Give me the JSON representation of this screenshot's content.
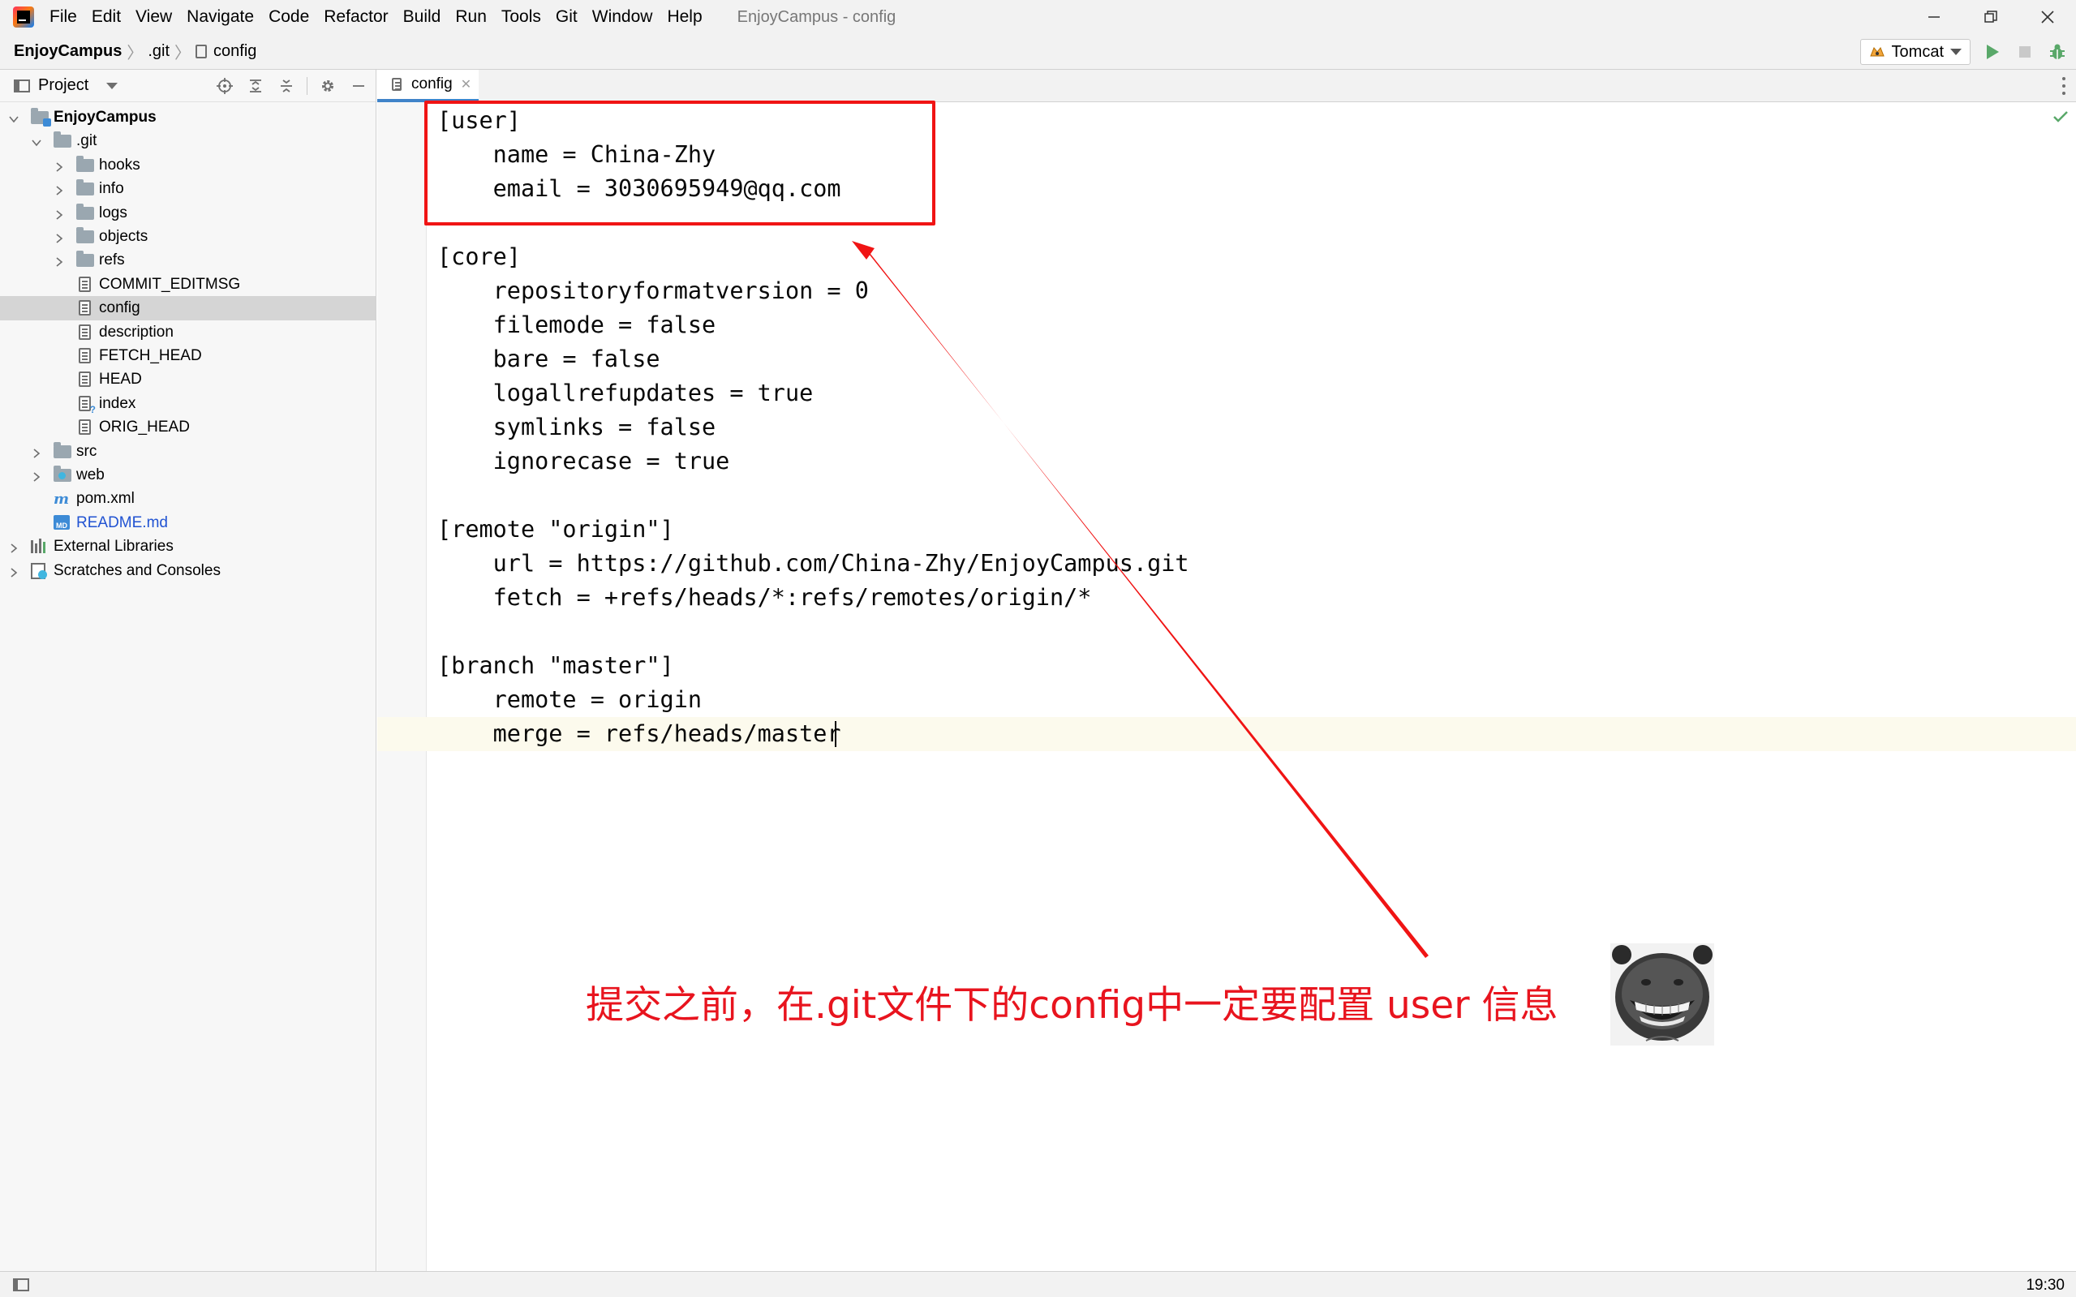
{
  "menubar": {
    "items": [
      "File",
      "Edit",
      "View",
      "Navigate",
      "Code",
      "Refactor",
      "Build",
      "Run",
      "Tools",
      "Git",
      "Window",
      "Help"
    ],
    "window_title": "EnjoyCampus - config"
  },
  "navbar": {
    "breadcrumb": [
      "EnjoyCampus",
      ".git",
      "config"
    ],
    "run_config": "Tomcat"
  },
  "project_panel": {
    "title": "Project",
    "tree": [
      {
        "label": "EnjoyCampus",
        "depth": 0,
        "icon": "module-folder-icon",
        "expanded": true,
        "bold": true
      },
      {
        "label": ".git",
        "depth": 1,
        "icon": "folder-icon",
        "expanded": true
      },
      {
        "label": "hooks",
        "depth": 2,
        "icon": "folder-icon",
        "expanded": false
      },
      {
        "label": "info",
        "depth": 2,
        "icon": "folder-icon",
        "expanded": false
      },
      {
        "label": "logs",
        "depth": 2,
        "icon": "folder-icon",
        "expanded": false
      },
      {
        "label": "objects",
        "depth": 2,
        "icon": "folder-icon",
        "expanded": false
      },
      {
        "label": "refs",
        "depth": 2,
        "icon": "folder-icon",
        "expanded": false
      },
      {
        "label": "COMMIT_EDITMSG",
        "depth": 2,
        "icon": "text-file-icon"
      },
      {
        "label": "config",
        "depth": 2,
        "icon": "text-file-icon",
        "selected": true
      },
      {
        "label": "description",
        "depth": 2,
        "icon": "text-file-icon"
      },
      {
        "label": "FETCH_HEAD",
        "depth": 2,
        "icon": "text-file-icon"
      },
      {
        "label": "HEAD",
        "depth": 2,
        "icon": "text-file-icon"
      },
      {
        "label": "index",
        "depth": 2,
        "icon": "unknown-file-icon"
      },
      {
        "label": "ORIG_HEAD",
        "depth": 2,
        "icon": "text-file-icon"
      },
      {
        "label": "src",
        "depth": 1,
        "icon": "folder-icon",
        "expanded": false
      },
      {
        "label": "web",
        "depth": 1,
        "icon": "web-folder-icon",
        "expanded": false
      },
      {
        "label": "pom.xml",
        "depth": 1,
        "icon": "maven-icon"
      },
      {
        "label": "README.md",
        "depth": 1,
        "icon": "markdown-icon",
        "color": "#2153d2"
      },
      {
        "label": "External Libraries",
        "depth": 0,
        "icon": "libraries-icon",
        "expanded": false
      },
      {
        "label": "Scratches and Consoles",
        "depth": 0,
        "icon": "scratches-icon",
        "expanded": false
      }
    ]
  },
  "editor": {
    "tab_label": "config",
    "lines": [
      "[user]",
      "    name = China-Zhy",
      "    email = 3030695949@qq.com",
      "",
      "[core]",
      "    repositoryformatversion = 0",
      "    filemode = false",
      "    bare = false",
      "    logallrefupdates = true",
      "    symlinks = false",
      "    ignorecase = true",
      "",
      "[remote \"origin\"]",
      "    url = https://github.com/China-Zhy/EnjoyCampus.git",
      "    fetch = +refs/heads/*:refs/remotes/origin/*",
      "",
      "[branch \"master\"]",
      "    remote = origin",
      "    merge = refs/heads/master"
    ]
  },
  "annotation": {
    "text": "提交之前，在.git文件下的config中一定要配置 user 信息",
    "color": "#e8141e"
  },
  "statusbar": {
    "position": "19:30"
  },
  "colors": {
    "accent": "#4083c9",
    "selection": "#d5d5d5",
    "current_line": "#fcfaed",
    "annotation_red": "#f01414"
  }
}
